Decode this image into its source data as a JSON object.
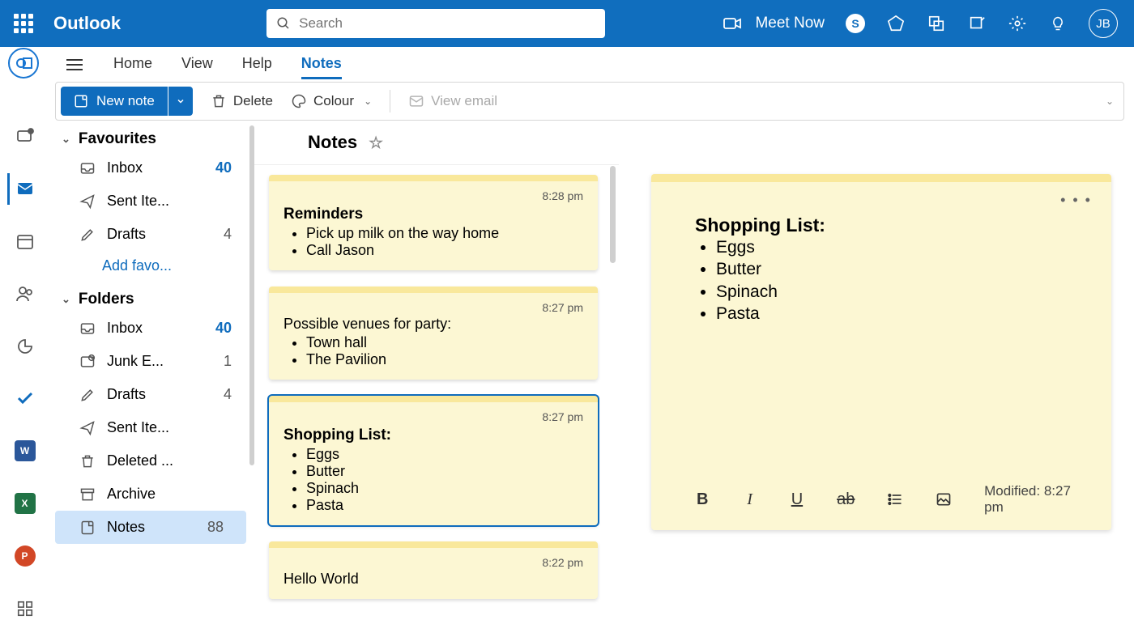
{
  "brand": "Outlook",
  "search": {
    "placeholder": "Search"
  },
  "meet_now": "Meet Now",
  "avatar_initials": "JB",
  "tabs": {
    "home": "Home",
    "view": "View",
    "help": "Help",
    "notes": "Notes"
  },
  "toolbar": {
    "new_note": "New note",
    "delete": "Delete",
    "colour": "Colour",
    "view_email": "View email"
  },
  "folder_pane": {
    "favourites": "Favourites",
    "folders": "Folders",
    "add_favourite": "Add favo...",
    "fav_items": [
      {
        "label": "Inbox",
        "count": "40",
        "bold": true
      },
      {
        "label": "Sent Ite...",
        "count": ""
      },
      {
        "label": "Drafts",
        "count": "4"
      }
    ],
    "folder_items": [
      {
        "label": "Inbox",
        "count": "40",
        "bold": true
      },
      {
        "label": "Junk E...",
        "count": "1"
      },
      {
        "label": "Drafts",
        "count": "4"
      },
      {
        "label": "Sent Ite...",
        "count": ""
      },
      {
        "label": "Deleted ...",
        "count": ""
      },
      {
        "label": "Archive",
        "count": ""
      },
      {
        "label": "Notes",
        "count": "88"
      }
    ]
  },
  "notes_header": "Notes",
  "notes": [
    {
      "time": "8:28 pm",
      "title": "Reminders",
      "items": [
        "Pick up milk on the way home",
        "Call Jason"
      ]
    },
    {
      "time": "8:27 pm",
      "title": "",
      "lead": "Possible venues for party:",
      "items": [
        "Town hall",
        "The Pavilion"
      ]
    },
    {
      "time": "8:27 pm",
      "title": "Shopping List:",
      "items": [
        "Eggs",
        "Butter",
        "Spinach",
        "Pasta"
      ],
      "selected": true
    },
    {
      "time": "8:22 pm",
      "title": "",
      "lead": "Hello World",
      "items": []
    }
  ],
  "big_note": {
    "title": "Shopping List:",
    "items": [
      "Eggs",
      "Butter",
      "Spinach",
      "Pasta"
    ],
    "modified": "Modified: 8:27 pm"
  }
}
